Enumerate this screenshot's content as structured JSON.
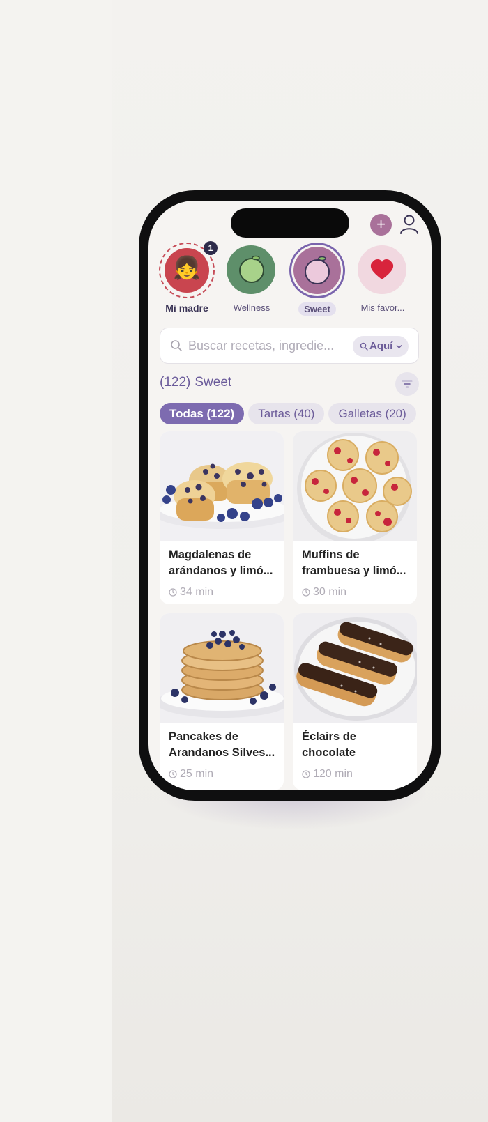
{
  "header": {
    "add_icon_glyph": "+"
  },
  "stories": [
    {
      "label": "Mi madre",
      "badge": "1",
      "emoji": "👧",
      "icon": "girl-avatar-icon"
    },
    {
      "label": "Wellness",
      "icon": "green-apple-icon"
    },
    {
      "label": "Sweet",
      "icon": "pink-plum-icon"
    },
    {
      "label": "Mis favor...",
      "icon": "heart-icon"
    }
  ],
  "search": {
    "placeholder": "Buscar recetas, ingredie...",
    "scope_label": "Aquí"
  },
  "section": {
    "count": "(122)",
    "title": "Sweet"
  },
  "chips": [
    "Todas (122)",
    "Tartas (40)",
    "Galletas (20)"
  ],
  "recipes": [
    {
      "name": "Magdalenas de arándanos y limó...",
      "time": "34 min"
    },
    {
      "name": "Muffins de frambuesa y limó...",
      "time": "30 min"
    },
    {
      "name": "Pancakes de Arandanos Silves...",
      "time": "25 min"
    },
    {
      "name": "Éclairs de chocolate",
      "time": "120 min"
    }
  ],
  "colors": {
    "accent": "#7d6bb0",
    "add_button": "#a9719a",
    "badge": "#2d2a4a"
  }
}
